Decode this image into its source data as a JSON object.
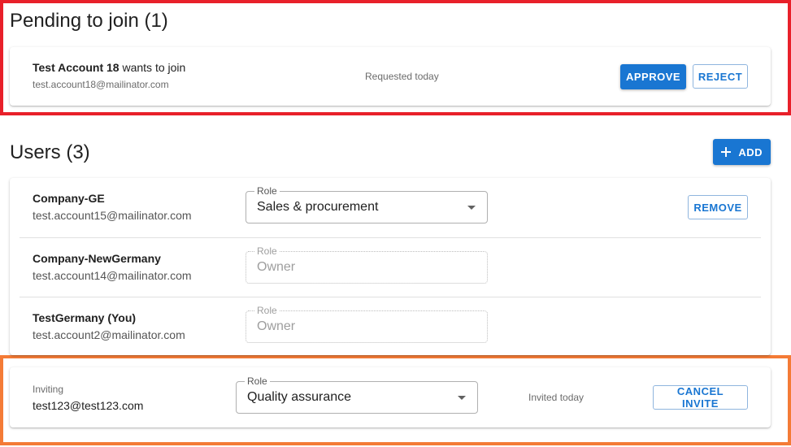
{
  "pending": {
    "title": "Pending to join (1)",
    "request": {
      "name": "Test Account 18",
      "action_text": " wants to join",
      "email": "test.account18@mailinator.com",
      "status": "Requested today",
      "approve_label": "APPROVE",
      "reject_label": "REJECT"
    }
  },
  "users": {
    "title": "Users (3)",
    "add_label": "ADD",
    "role_label": "Role",
    "list": [
      {
        "name": "Company-GE",
        "email": "test.account15@mailinator.com",
        "role": "Sales & procurement",
        "editable": true,
        "remove_label": "REMOVE"
      },
      {
        "name": "Company-NewGermany",
        "email": "test.account14@mailinator.com",
        "role": "Owner",
        "editable": false
      },
      {
        "name": "TestGermany (You)",
        "email": "test.account2@mailinator.com",
        "role": "Owner",
        "editable": false
      }
    ]
  },
  "invite": {
    "status_label": "Inviting",
    "email": "test123@test123.com",
    "role_label": "Role",
    "role": "Quality assurance",
    "invited_text": "Invited today",
    "cancel_label": "CANCEL INVITE"
  },
  "colors": {
    "accent": "#1976d2",
    "highlight_red": "#e8202a",
    "highlight_orange": "#f47b36"
  }
}
